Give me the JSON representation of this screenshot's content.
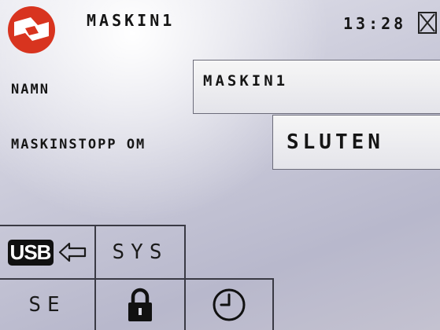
{
  "header": {
    "title": "MASKIN1",
    "time": "13:28",
    "logo_icon": "brand-logo-icon",
    "close_icon": "close-x-icon"
  },
  "fields": {
    "name_label": "NAMN",
    "name_value": "MASKIN1",
    "stop_label": "MASKINSTOPP OM",
    "stop_value": "SLUTEN"
  },
  "buttons": {
    "usb_label": "USB",
    "usb_arrow_icon": "arrow-left-icon",
    "sys_label": "SYS",
    "se_label": "SE",
    "lock_icon": "lock-icon",
    "clock_icon": "clock-icon"
  },
  "colors": {
    "logo_red": "#d8341f",
    "text": "#151515",
    "field_bg": "#f0f0f2",
    "screen_bg": "#c8c8d8"
  }
}
